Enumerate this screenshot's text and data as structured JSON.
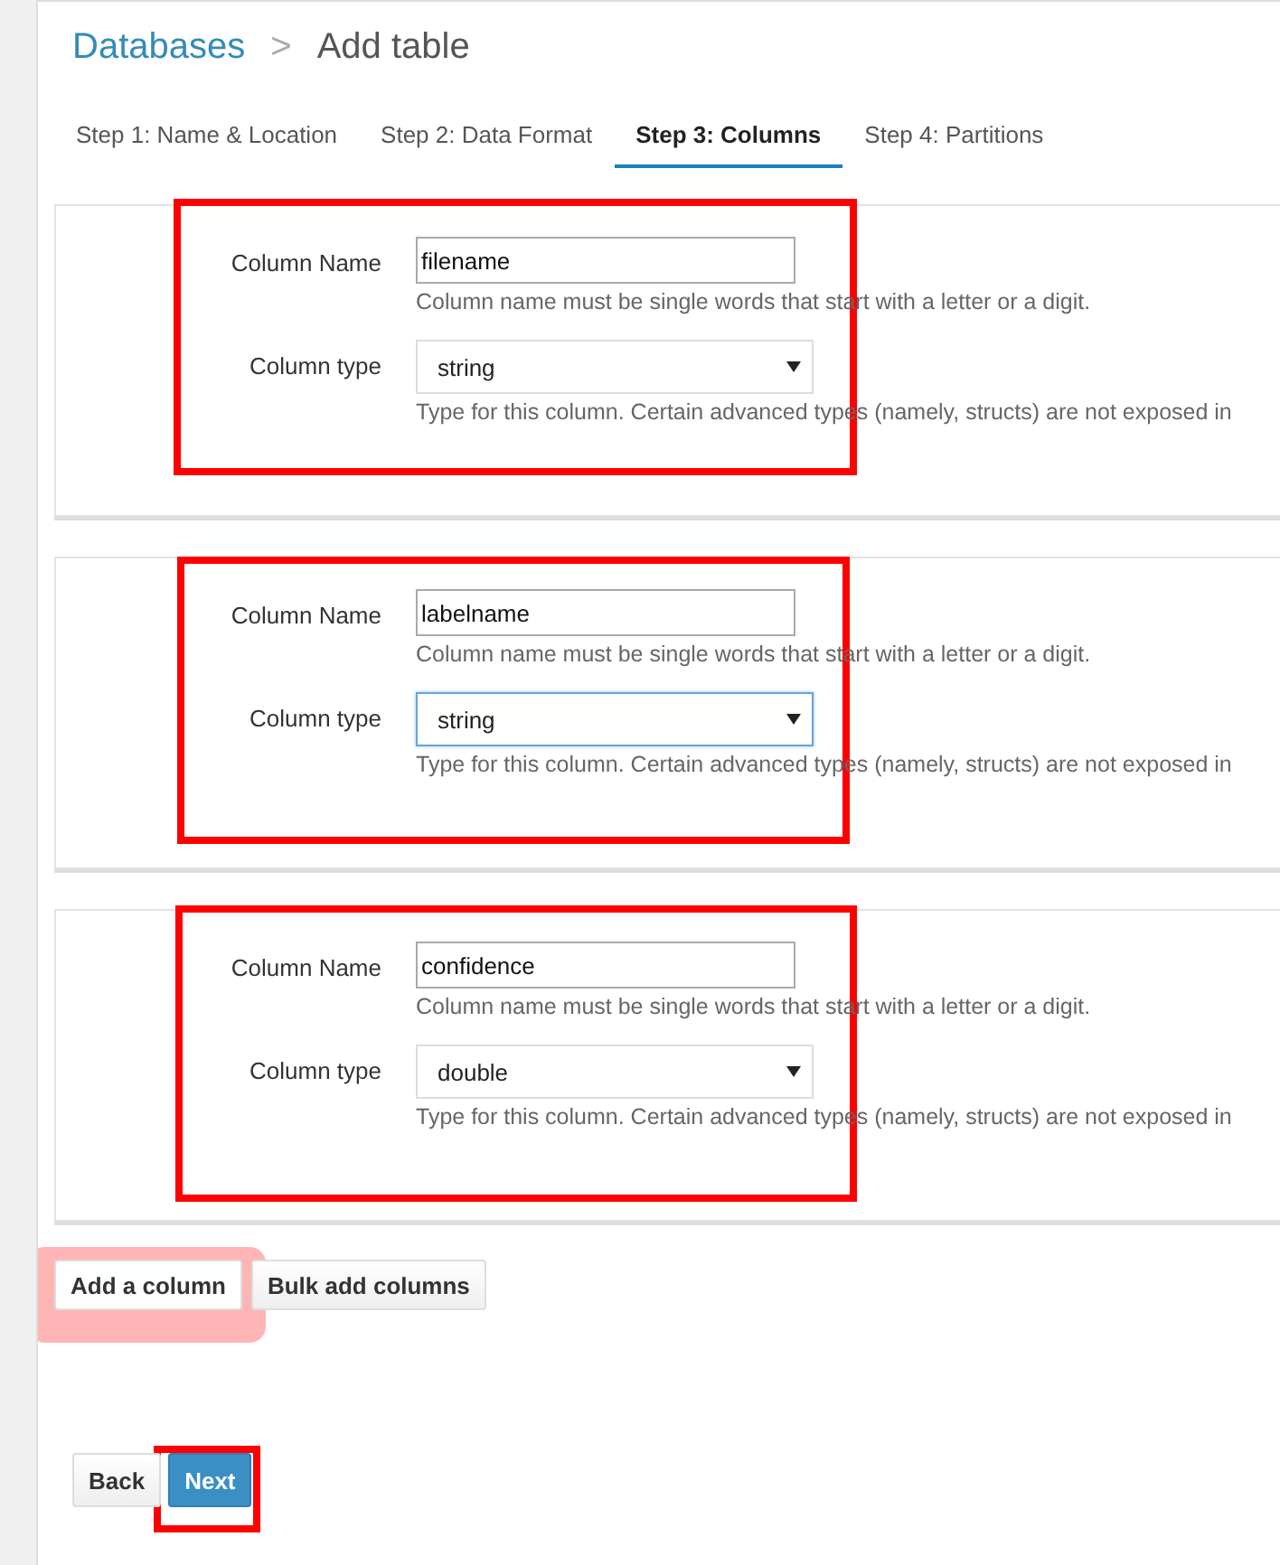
{
  "breadcrumb": {
    "parent": "Databases",
    "separator": ">",
    "current": "Add table"
  },
  "tabs": [
    {
      "label": "Step 1: Name & Location",
      "selected": false
    },
    {
      "label": "Step 2: Data Format",
      "selected": false
    },
    {
      "label": "Step 3: Columns",
      "selected": true
    },
    {
      "label": "Step 4: Partitions",
      "selected": false
    }
  ],
  "columns": [
    {
      "name_label": "Column Name",
      "name_value": "filename",
      "name_help": "Column name must be single words that start with a letter or a digit.",
      "type_label": "Column type",
      "type_value": "string",
      "type_focused": false,
      "type_help": "Type for this column. Certain advanced types (namely, structs) are not exposed in"
    },
    {
      "name_label": "Column Name",
      "name_value": "labelname",
      "name_help": "Column name must be single words that start with a letter or a digit.",
      "type_label": "Column type",
      "type_value": "string",
      "type_focused": true,
      "type_help": "Type for this column. Certain advanced types (namely, structs) are not exposed in"
    },
    {
      "name_label": "Column Name",
      "name_value": "confidence",
      "name_help": "Column name must be single words that start with a letter or a digit.",
      "type_label": "Column type",
      "type_value": "double",
      "type_focused": false,
      "type_help": "Type for this column. Certain advanced types (namely, structs) are not exposed in"
    }
  ],
  "column_actions": [
    {
      "label": "Add a column",
      "highlighted": true
    },
    {
      "label": "Bulk add columns",
      "highlighted": false
    }
  ],
  "nav_buttons": [
    {
      "label": "Back",
      "kind": "default"
    },
    {
      "label": "Next",
      "kind": "primary"
    }
  ]
}
